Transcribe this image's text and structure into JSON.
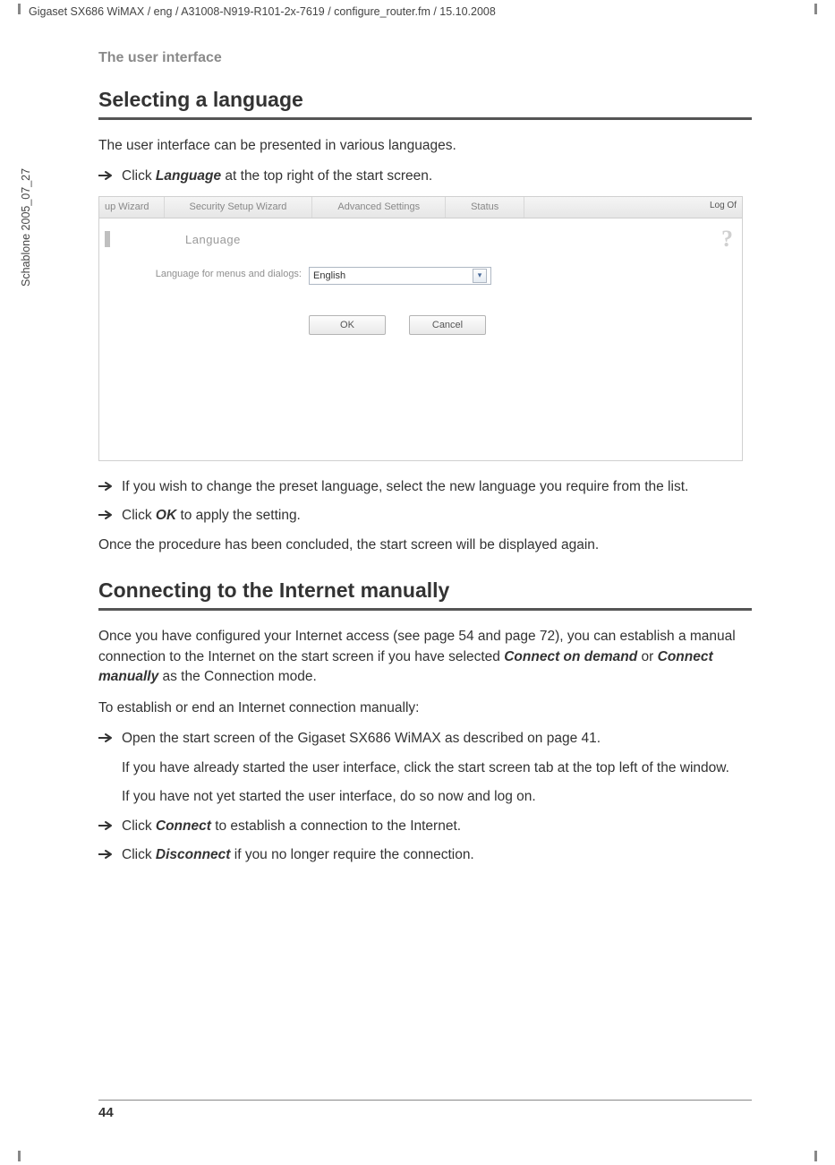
{
  "doc": {
    "header_path": "Gigaset SX686 WiMAX / eng / A31008-N919-R101-2x-7619 / configure_router.fm / 15.10.2008",
    "side_template": "Schablone 2005_07_27",
    "running_head": "The user interface",
    "page_number": "44"
  },
  "section1": {
    "title": "Selecting a language",
    "intro": "The user interface can be presented in various languages.",
    "step1_pre": "Click ",
    "step1_bi": "Language",
    "step1_post": " at the top right of the start screen.",
    "step2": "If you wish to change the preset language, select the new language you require from the list.",
    "step3_pre": "Click ",
    "step3_bi": "OK",
    "step3_post": " to apply the setting.",
    "outro": "Once the procedure has been concluded, the start screen will be displayed again."
  },
  "ui": {
    "tabs": {
      "t1": "up Wizard",
      "t2": "Security Setup Wizard",
      "t3": "Advanced Settings",
      "t4": "Status"
    },
    "logoff": "Log Of",
    "panel_title": "Language",
    "field_label": "Language for menus and dialogs:",
    "select_value": "English",
    "btn_ok": "OK",
    "btn_cancel": "Cancel",
    "help_glyph": "?"
  },
  "section2": {
    "title": "Connecting to the Internet manually",
    "p1_pre": "Once you have configured your Internet access (see page 54 and page 72), you can establish a manual connection to the Internet on the start screen if you have selected ",
    "p1_bi1": "Connect on demand",
    "p1_mid": " or ",
    "p1_bi2": "Connect manually",
    "p1_post": " as the Connection mode.",
    "p2": "To establish or end an Internet connection manually:",
    "step1": "Open the start screen of the Gigaset SX686 WiMAX as described on page 41.",
    "step1_sub1": "If you have already started the user interface, click the start screen tab at the top left of the window.",
    "step1_sub2": "If you have not yet started the user interface, do so now and log on.",
    "step2_pre": "Click ",
    "step2_bi": "Connect",
    "step2_post": " to establish a connection to the Internet.",
    "step3_pre": "Click ",
    "step3_bi": "Disconnect",
    "step3_post": " if you no longer require the connection."
  }
}
